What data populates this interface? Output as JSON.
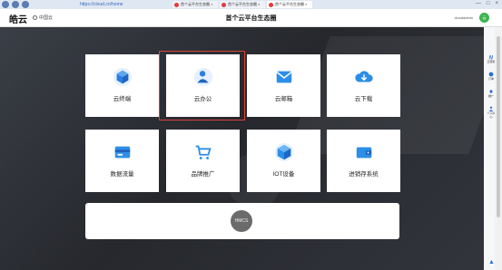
{
  "browser": {
    "url": "https://cloud.cn/home",
    "tabs": [
      {
        "label": "首个云平台生态圈 ×"
      },
      {
        "label": "首个云平台生态圈 ×"
      },
      {
        "label": "首个云平台生态圈 ×"
      }
    ],
    "window_controls": [
      "—",
      "□",
      "×"
    ]
  },
  "header": {
    "logo": "皓云",
    "location": "中国云",
    "title": "首个云平台生态圈",
    "user_name": "cloudadmin",
    "avatar_text": "云"
  },
  "cards": [
    {
      "label": "云终端",
      "icon": "cube-icon",
      "color": "#3d8fe8"
    },
    {
      "label": "云办公",
      "icon": "office-icon",
      "color": "#2d7de0"
    },
    {
      "label": "云邮箱",
      "icon": "mail-icon",
      "color": "#2d8ee8"
    },
    {
      "label": "云下载",
      "icon": "cloud-download-icon",
      "color": "#2b8de6"
    },
    {
      "label": "数据流量",
      "icon": "data-card-icon",
      "color": "#2f8fe8"
    },
    {
      "label": "品牌推广",
      "icon": "cart-icon",
      "color": "#2d8de6"
    },
    {
      "label": "IOT设备",
      "icon": "iot-box-icon",
      "color": "#2a90e7"
    },
    {
      "label": "进销存系统",
      "icon": "wallet-icon",
      "color": "#2b8fe6"
    }
  ],
  "banner": {
    "badge": "HMCS"
  },
  "sidebar": [
    {
      "label": "云服务",
      "icon": "n-icon"
    },
    {
      "label": "订单",
      "icon": "circle-icon"
    },
    {
      "label": "推广",
      "icon": "pin-icon"
    },
    {
      "label": "个人中心",
      "icon": "user-icon"
    }
  ],
  "colors": {
    "accent": "#2d8de6",
    "selection": "#d9433a",
    "brand_green": "#3fb34f"
  }
}
